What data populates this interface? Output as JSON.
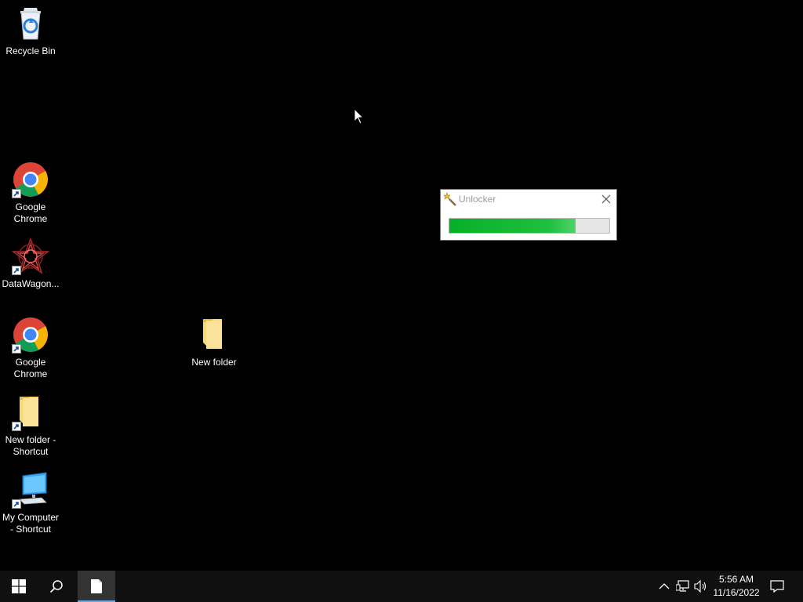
{
  "desktop": {
    "icons": [
      {
        "label": "Recycle Bin",
        "icon": "recycle-bin-icon"
      },
      {
        "label": "Google\nChrome",
        "icon": "chrome-icon"
      },
      {
        "label": "DataWagon...",
        "icon": "datawagon-icon"
      },
      {
        "label": "Google\nChrome",
        "icon": "chrome-icon"
      },
      {
        "label": "New folder -\nShortcut",
        "icon": "folder-icon"
      },
      {
        "label": "My Computer\n- Shortcut",
        "icon": "computer-icon"
      },
      {
        "label": "New folder",
        "icon": "folder-icon"
      }
    ]
  },
  "dialog": {
    "title": "Unlocker",
    "progress_fraction": 0.79,
    "accent": "#06b025"
  },
  "taskbar": {
    "start": "windows-logo-icon",
    "search": "search-icon",
    "active_app": "document-icon",
    "tray": [
      "chevron-up-icon",
      "network-icon",
      "volume-icon"
    ],
    "time": "5:56 AM",
    "date": "11/16/2022",
    "notifications": "notification-icon"
  }
}
